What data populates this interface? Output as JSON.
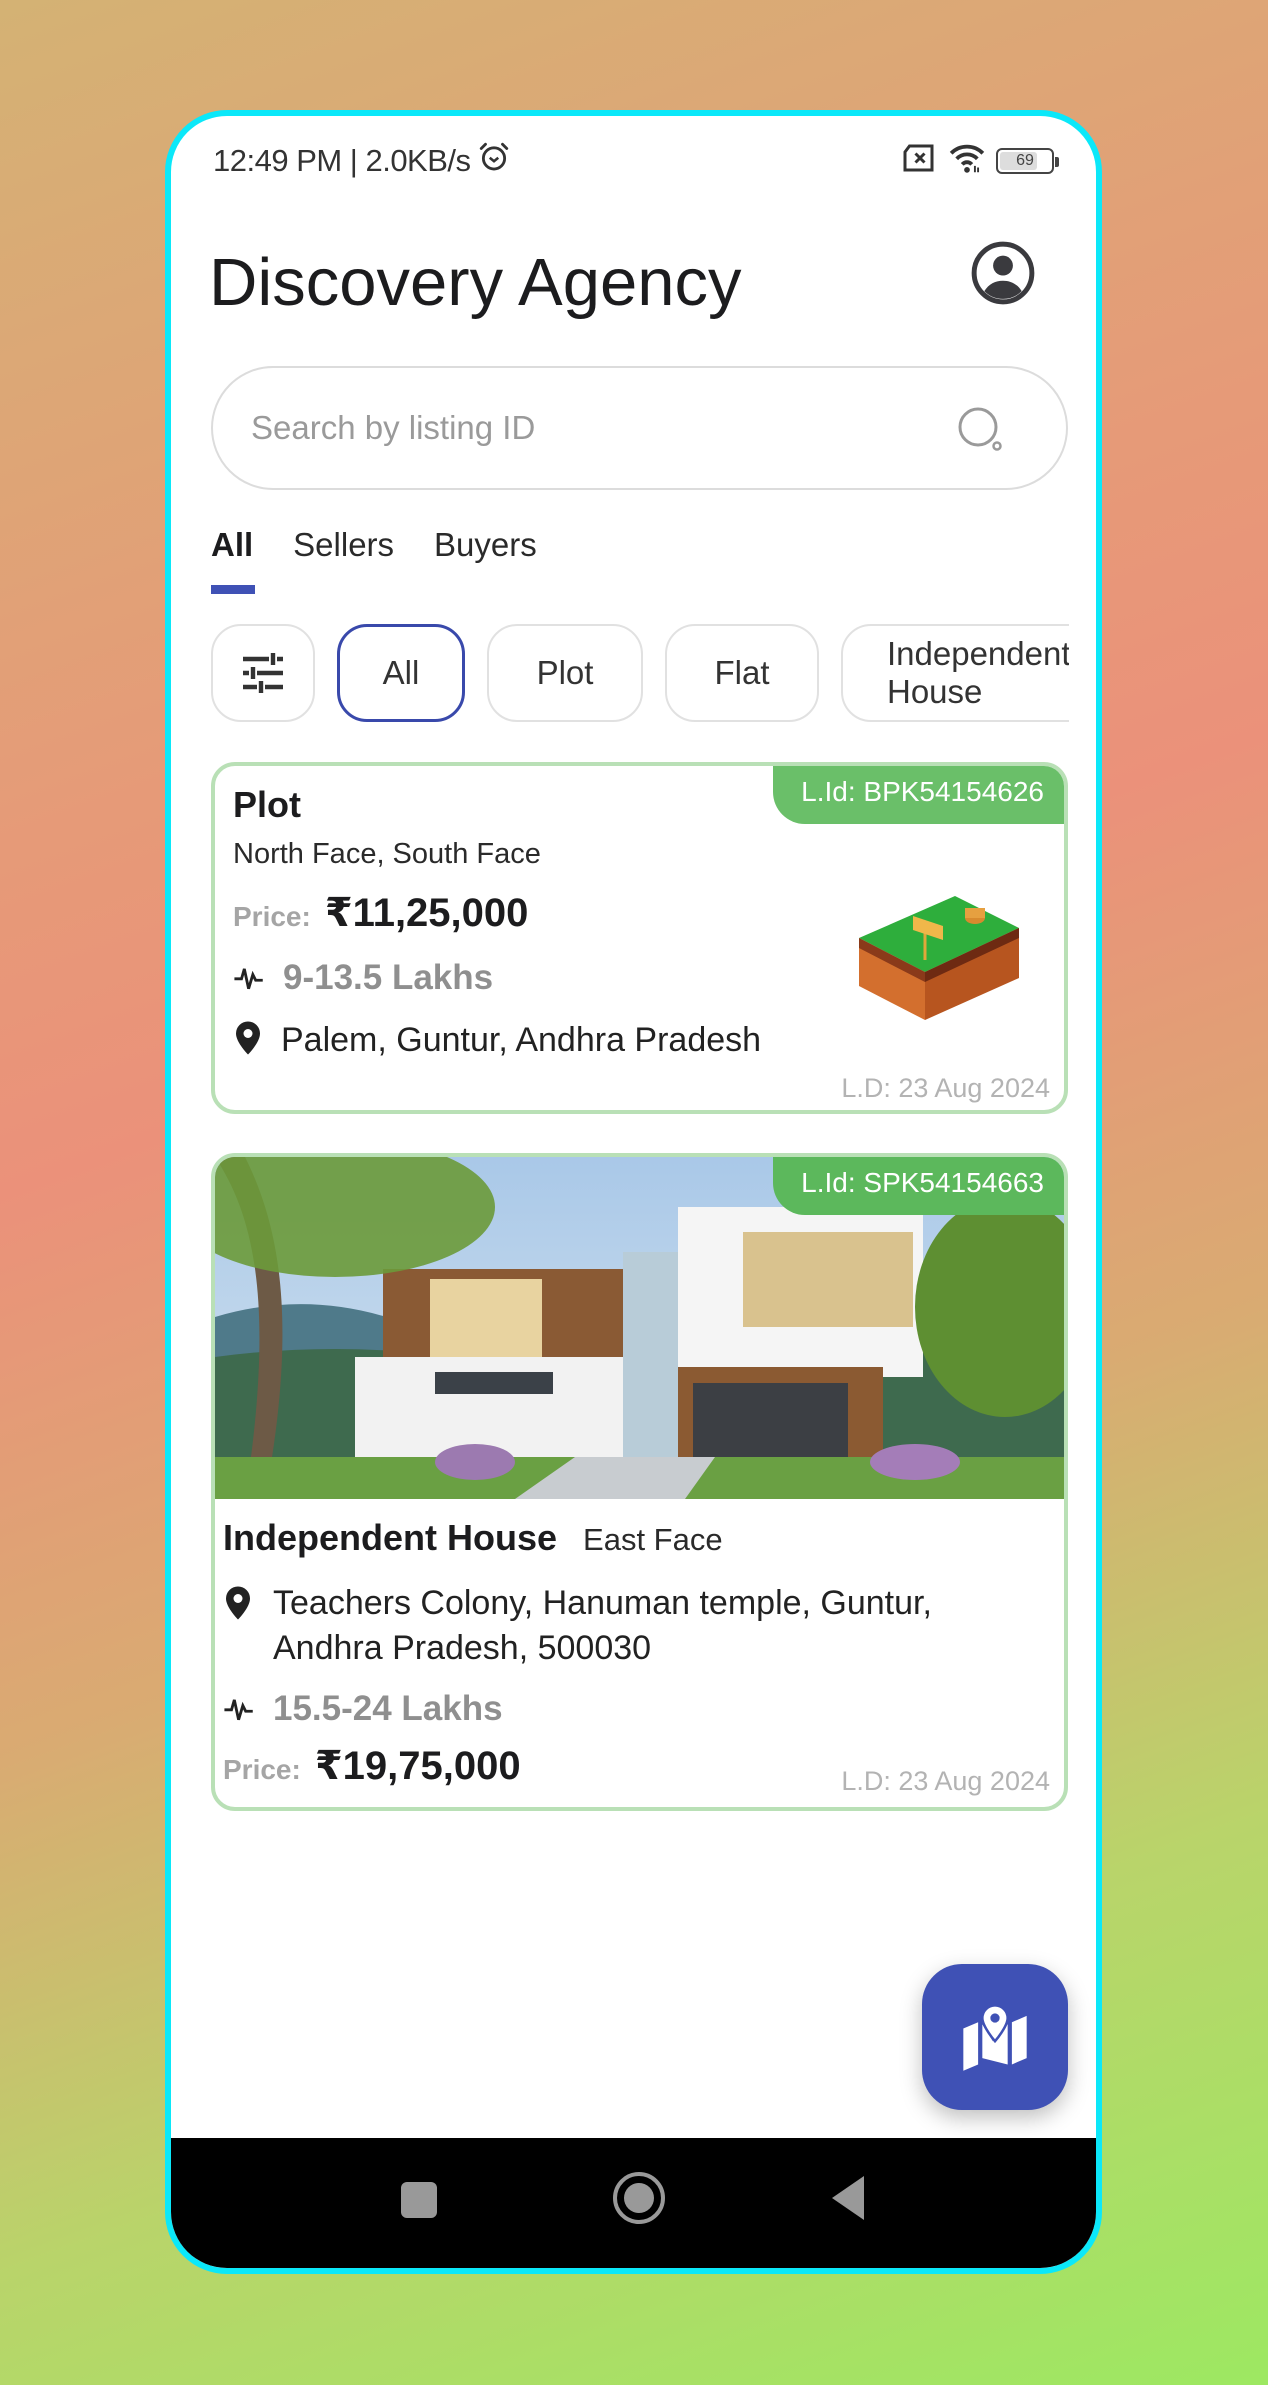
{
  "status_bar": {
    "time_speed": "12:49 PM | 2.0KB/s",
    "battery": "69",
    "icons": [
      "alarm-icon",
      "no-sim-icon",
      "wifi-icon",
      "battery-icon"
    ]
  },
  "header": {
    "title": "Discovery Agency",
    "profile_icon": "account-circle-icon"
  },
  "search": {
    "placeholder": "Search by listing ID",
    "value": "",
    "icon": "search-icon"
  },
  "tabs": [
    {
      "label": "All",
      "active": true
    },
    {
      "label": "Sellers",
      "active": false
    },
    {
      "label": "Buyers",
      "active": false
    }
  ],
  "chips": {
    "filter_icon": "tune-icon",
    "items": [
      {
        "label": "All",
        "selected": true
      },
      {
        "label": "Plot",
        "selected": false
      },
      {
        "label": "Flat",
        "selected": false
      },
      {
        "label": "Independent House",
        "selected": false
      }
    ]
  },
  "listings": [
    {
      "listing_id_label": "L.Id: BPK54154626",
      "type": "Plot",
      "facing": "North Face, South Face",
      "price_label": "Price:",
      "price": "₹11,25,000",
      "range": "9-13.5 Lakhs",
      "location": "Palem, Guntur, Andhra Pradesh",
      "date": "L.D: 23 Aug 2024",
      "image": "plot-land-illustration"
    },
    {
      "listing_id_label": "L.Id: SPK54154663",
      "type": "Independent House",
      "facing": "East Face",
      "location_line1": "Teachers Colony, Hanuman temple, Guntur,",
      "location_line2": "Andhra Pradesh, 500030",
      "range": "15.5-24 Lakhs",
      "price_label": "Price:",
      "price": "₹19,75,000",
      "date": "L.D: 23 Aug 2024",
      "image": "modern-house-photo"
    }
  ],
  "fab": {
    "icon": "map-location-icon"
  },
  "nav_bar": {
    "buttons": [
      "recents",
      "home",
      "back"
    ]
  },
  "colors": {
    "accent": "#3f51b5",
    "badge_green": "#6abf69",
    "card_border": "#b9e0b6",
    "frame_border": "#0be8f9"
  }
}
